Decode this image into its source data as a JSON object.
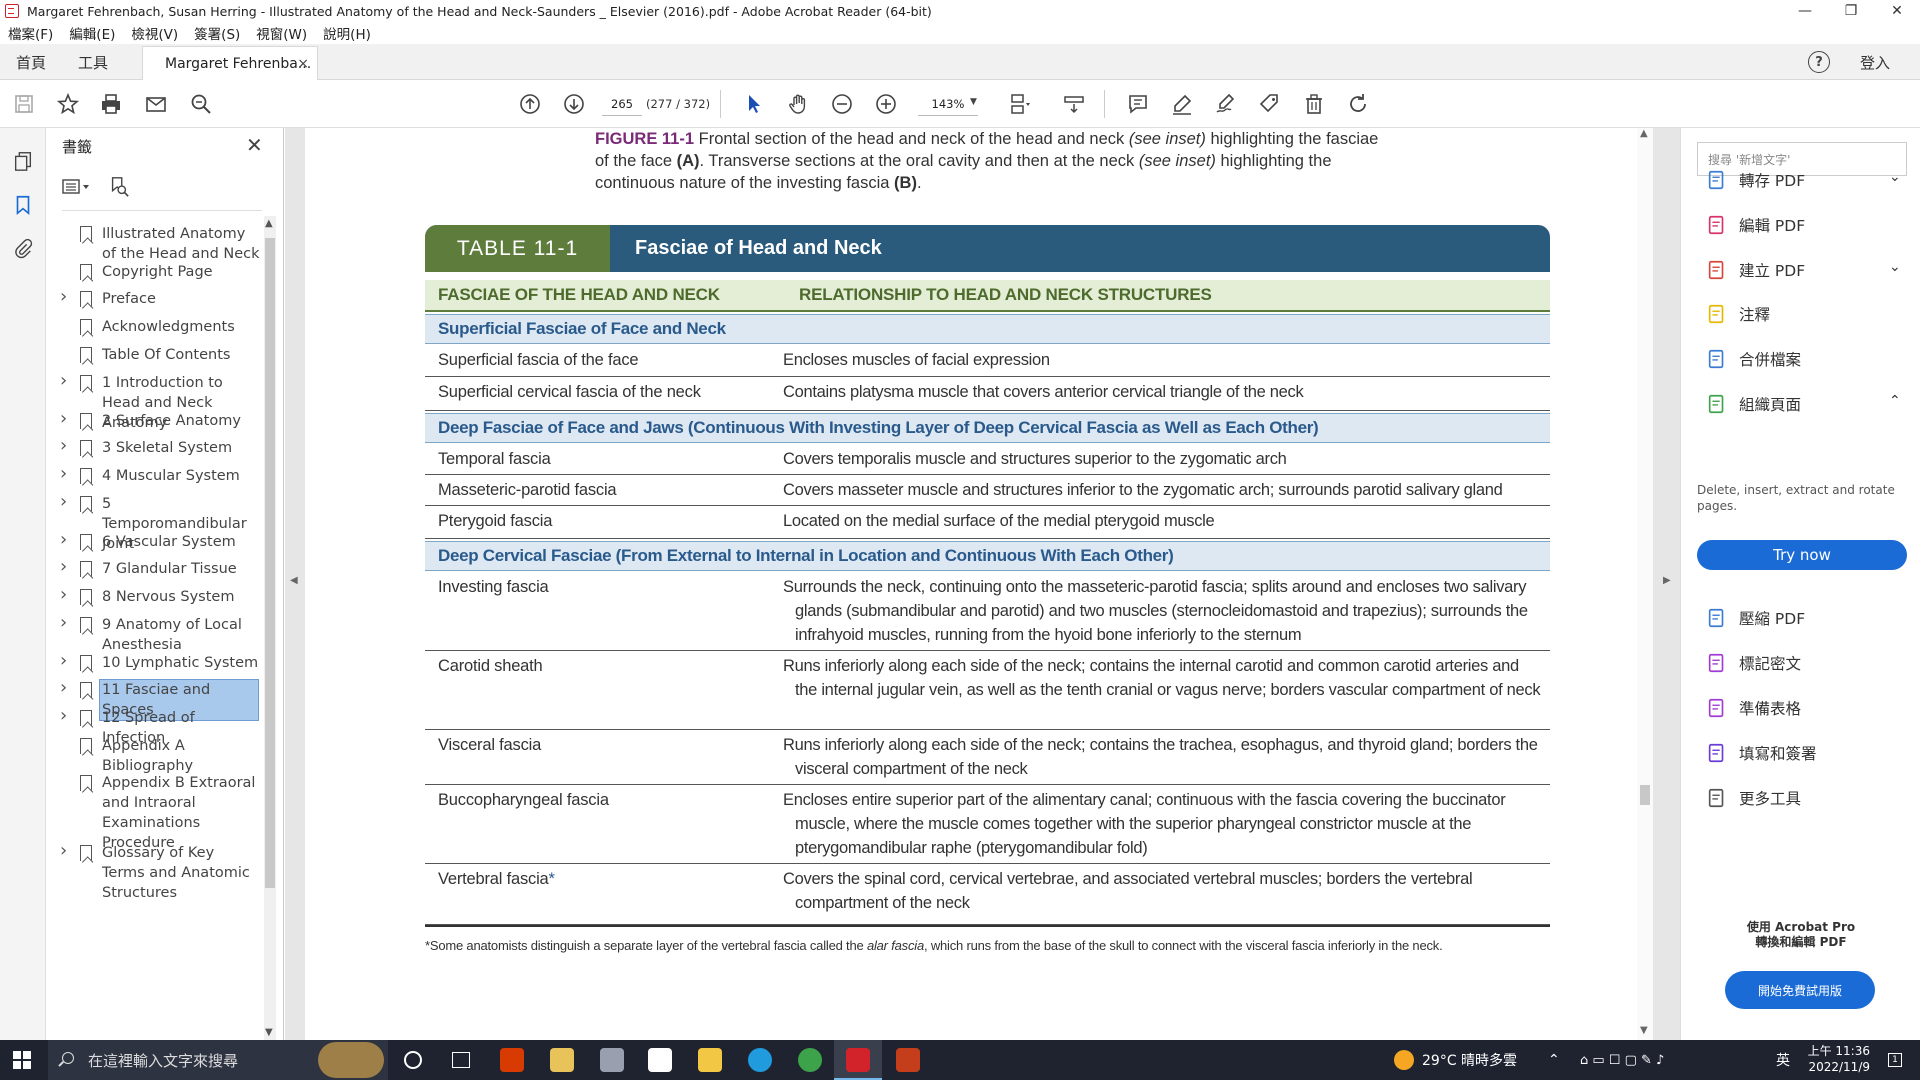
{
  "window": {
    "title": "Margaret Fehrenbach, Susan Herring - Illustrated Anatomy of the Head and Neck-Saunders _ Elsevier (2016).pdf - Adobe Acrobat Reader (64-bit)",
    "minimize": "—",
    "maximize": "❐",
    "close": "✕"
  },
  "menu": [
    "檔案(F)",
    "編輯(E)",
    "檢視(V)",
    "簽署(S)",
    "視窗(W)",
    "說明(H)"
  ],
  "tabs": {
    "home": "首頁",
    "tools": "工具",
    "document": "Margaret Fehrenba...",
    "close": "×",
    "help": "?",
    "signin": "登入"
  },
  "toolbar": {
    "page_current": "265",
    "page_count": "(277 / 372)",
    "zoom": "143%"
  },
  "bookmarks": {
    "title": "書籤",
    "close": "✕",
    "items": [
      {
        "label": "Illustrated Anatomy of the Head and Neck",
        "expandable": false
      },
      {
        "label": "Copyright Page",
        "expandable": false
      },
      {
        "label": "Preface",
        "expandable": true
      },
      {
        "label": "Acknowledgments",
        "expandable": false
      },
      {
        "label": "Table Of Contents",
        "expandable": false
      },
      {
        "label": "1 Introduction to Head and Neck Anatomy",
        "expandable": true
      },
      {
        "label": "2 Surface Anatomy",
        "expandable": true
      },
      {
        "label": "3 Skeletal System",
        "expandable": true
      },
      {
        "label": "4 Muscular System",
        "expandable": true
      },
      {
        "label": "5 Temporomandibular Joint",
        "expandable": true
      },
      {
        "label": "6 Vascular System",
        "expandable": true
      },
      {
        "label": "7 Glandular Tissue",
        "expandable": true
      },
      {
        "label": "8 Nervous System",
        "expandable": true
      },
      {
        "label": "9 Anatomy of Local Anesthesia",
        "expandable": true
      },
      {
        "label": "10 Lymphatic System",
        "expandable": true
      },
      {
        "label": "11 Fasciae and Spaces",
        "expandable": true,
        "selected": true
      },
      {
        "label": "12 Spread of Infection",
        "expandable": true
      },
      {
        "label": "Appendix A Bibliography",
        "expandable": false
      },
      {
        "label": "Appendix B Extraoral and Intraoral Examinations Procedure",
        "expandable": false
      },
      {
        "label": "Glossary of Key Terms and Anatomic Structures",
        "expandable": true
      }
    ]
  },
  "document": {
    "caption": {
      "fig": "FIGURE 11-1",
      "text1": " Frontal section of the head and neck of the head and neck ",
      "inset1": "(see inset)",
      "text2": " highlighting the fasciae of the face ",
      "a": "(A)",
      "text3": ". Transverse sections at the oral cavity and then at the neck ",
      "inset2": "(see inset)",
      "text4": " highlighting the continuous nature of the investing fascia ",
      "b": "(B)",
      "text5": "."
    },
    "table": {
      "number": "TABLE 11-1",
      "title": "Fasciae of Head and Neck",
      "col1": "FASCIAE OF THE HEAD AND NECK",
      "col2": "RELATIONSHIP TO HEAD AND NECK STRUCTURES",
      "sections": [
        "Superficial Fasciae of Face and Neck",
        "Deep Fasciae of Face and Jaws (Continuous With Investing Layer of Deep Cervical Fascia as Well as Each Other)",
        "Deep Cervical Fasciae (From External to Internal in Location and Continuous With Each Other)"
      ],
      "rows": [
        {
          "name": "Superficial fascia of the face",
          "desc": "Encloses muscles of facial expression"
        },
        {
          "name": "Superficial cervical fascia of the neck",
          "desc": "Contains platysma muscle that covers anterior cervical triangle of the neck"
        },
        {
          "name": "Temporal fascia",
          "desc": "Covers temporalis muscle and structures superior to the zygomatic arch"
        },
        {
          "name": "Masseteric-parotid fascia",
          "desc": "Covers masseter muscle and structures inferior to the zygomatic arch; surrounds parotid salivary gland"
        },
        {
          "name": "Pterygoid fascia",
          "desc": "Located on the medial surface of the medial pterygoid muscle"
        },
        {
          "name": "Investing fascia",
          "desc": "Surrounds the neck, continuing onto the masseteric-parotid fascia; splits around and encloses two salivary glands (submandibular and parotid) and two muscles (sternocleidomastoid and trapezius); surrounds the infrahyoid muscles, running from the hyoid bone inferiorly to the sternum"
        },
        {
          "name": "Carotid sheath",
          "desc": "Runs inferiorly along each side of the neck; contains the internal carotid and common carotid arteries and the internal jugular vein, as well as the tenth cranial or vagus nerve; borders vascular compartment of neck"
        },
        {
          "name": "Visceral fascia",
          "desc": "Runs inferiorly along each side of the neck; contains the trachea, esophagus, and thyroid gland; borders the visceral compartment of the neck"
        },
        {
          "name": "Buccopharyngeal fascia",
          "desc": "Encloses entire superior part of the alimentary canal; continuous with the fascia covering the buccinator muscle, where the muscle comes together with the superior pharyngeal constrictor muscle at the pterygomandibular raphe (pterygomandibular fold)"
        },
        {
          "name": "Vertebral fascia",
          "star": "*",
          "desc": "Covers the spinal cord, cervical vertebrae, and associated vertebral muscles; borders the vertebral compartment of the neck"
        }
      ],
      "footnote_pre": "*Some anatomists distinguish a separate layer of the vertebral fascia called the ",
      "footnote_em": "alar fascia",
      "footnote_post": ", which runs from the base of the skull to connect with the visceral fascia inferiorly in the neck."
    }
  },
  "rightpanel": {
    "search_placeholder": "搜尋 '新增文字'",
    "tools": [
      {
        "label": "轉存 PDF",
        "icon": "export-pdf-icon",
        "chevron": "⌄"
      },
      {
        "label": "編輯 PDF",
        "icon": "edit-pdf-icon"
      },
      {
        "label": "建立 PDF",
        "icon": "create-pdf-icon",
        "chevron": "⌄"
      },
      {
        "label": "注釋",
        "icon": "comment-icon"
      },
      {
        "label": "合併檔案",
        "icon": "combine-files-icon"
      },
      {
        "label": "組織頁面",
        "icon": "organize-pages-icon",
        "chevron": "⌃"
      },
      {
        "label": "壓縮 PDF",
        "icon": "compress-pdf-icon"
      },
      {
        "label": "標記密文",
        "icon": "redact-icon"
      },
      {
        "label": "準備表格",
        "icon": "prepare-form-icon"
      },
      {
        "label": "填寫和簽署",
        "icon": "fill-sign-icon"
      },
      {
        "label": "更多工具",
        "icon": "more-tools-icon"
      }
    ],
    "organize_desc": "Delete, insert, extract and rotate pages.",
    "try_now": "Try now",
    "promo_line1": "使用 Acrobat Pro",
    "promo_line2": "轉換和編輯 PDF",
    "promo_button": "開始免費試用版"
  },
  "taskbar": {
    "search_placeholder": "在這裡輸入文字來搜尋",
    "weather": "29°C  晴時多雲",
    "ime": "英",
    "time": "上午 11:36",
    "date": "2022/11/9",
    "notify": "1"
  },
  "colors": {
    "table_header_green": "#5e7c3b",
    "table_header_blue": "#2a5a7c",
    "section_text": "#2a5a8c",
    "figure_label": "#7a2a77",
    "accent_blue": "#1b6bd6"
  }
}
